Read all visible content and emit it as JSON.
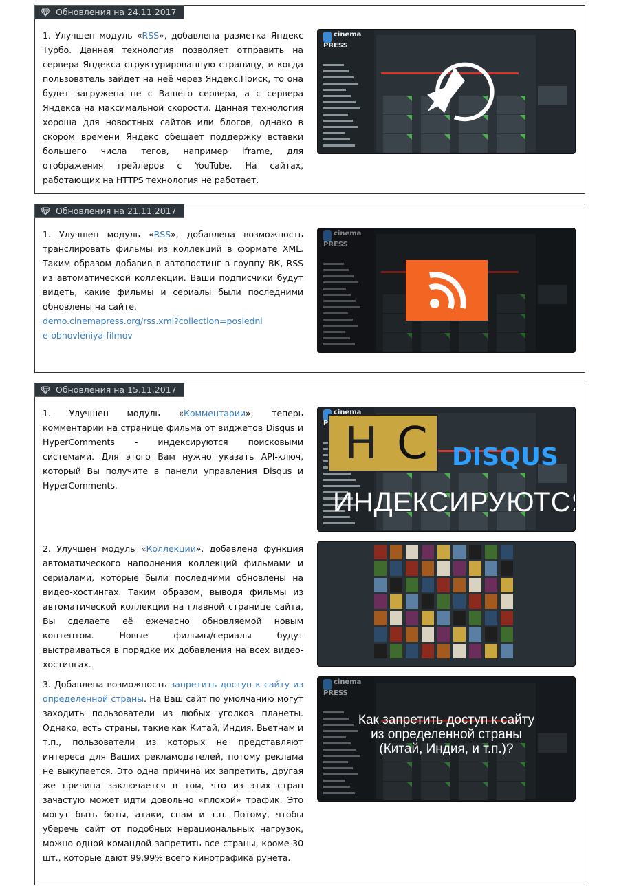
{
  "sections": [
    {
      "title": "Обновления на 24.11.2017",
      "items": [
        {
          "prefix": "1. Улучшен модуль «",
          "link": "RSS",
          "suffix": "», добавлена разметка Яндекс Турбо. Данная технология позволяет отправить на сервера Яндекса структурированную страницу, и когда пользователь зайдет на неё через Яндекс.Поиск, то она будет загружена не с Вашего сервера, а с сервера Яндекса на максимальной скорости. Данная технология хороша для новостных сайтов или блогов, однако в скором времени Яндекс обещает поддержку вставки большего числа тегов, например iframe, для отображения трейлеров с YouTube. На сайтах, работающих на HTTPS технология не работает.",
          "image": "cinemapress-admin-rocket"
        }
      ]
    },
    {
      "title": "Обновления на 21.11.2017",
      "items": [
        {
          "prefix": "1. Улучшен модуль «",
          "link": "RSS",
          "suffix": "», добавлена возможность транслировать фильмы из коллекций в формате XML. Таким образом добавив в автопостинг в группу ВК, RSS из автоматической коллекции. Ваши подписчики будут видеть, какие фильмы и сериалы были последними обновлены на сайте.",
          "url": "demo.cinemapress.org/rss.xml?collection=poslednie-obnovleniya-filmov",
          "image": "cinemapress-admin-rss"
        }
      ]
    },
    {
      "title": "Обновления на 15.11.2017",
      "items": [
        {
          "prefix": "1. Улучшен модуль «",
          "link": "Комментарии",
          "suffix": "», теперь комментарии на странице фильма от виджетов Disqus и HyperComments - индексируются поисковыми системами. Для этого Вам нужно указать API-ключ, который Вы получите в панели управления Disqus и HyperComments.",
          "image": "hc-disqus-banner",
          "banner": {
            "h": "H",
            "c": "C",
            "disqus": "DISQUS",
            "caption": "ИНДЕКСИРУЮТСЯ"
          }
        },
        {
          "prefix": "2. Улучшен модуль «",
          "link": "Коллекции",
          "suffix": "», добавлена функция автоматического наполнения коллекций фильмами и сериалами, которые были последними обновлены на видео-хостингах. Таким образом, выводя фильмы из автоматической коллекции на главной странице сайта, Вы сделаете её ежечасно обновляемой новым контентом. Новые фильмы/сериалы будут выстраиваться в порядке их добавления на всех видео-хостингах.",
          "image": "movie-posters-grid"
        },
        {
          "prefix": "3. Добавлена возможность ",
          "link": "запретить доступ к сайту из определенной страны",
          "suffix": ". На Ваш сайт по умолчанию могут заходить пользователи из любых уголков планеты. Однако, есть страны, такие как Китай, Индия, Вьетнам и т.п., пользователи из которых не представляют интереса для Ваших рекламодателей, потому реклама не выкупается. Это одна причина их запретить, другая же причина заключается в том, что из этих стран зачастую может идти довольно «плохой» трафик. Это могут быть боты, атаки, спам и т.п. Потому, чтобы уберечь сайт от подобных нерациональных нагрузок, можно одной командой запретить все страны, кроме 30 шт., которые дают 99.99% всего кинотрафика рунета.",
          "image": "country-ban-banner",
          "banner": {
            "line1": "Как запретить доступ к сайту",
            "line2": "из определенной страны",
            "line3": "(Китай, Индия, и т.п.)?"
          }
        }
      ]
    }
  ],
  "colors": {
    "tag_bg": "#2d343a",
    "link": "#3a7fc4",
    "rss": "#f26522",
    "disqus": "#2e9fff",
    "hc_gold": "#c9a640"
  }
}
